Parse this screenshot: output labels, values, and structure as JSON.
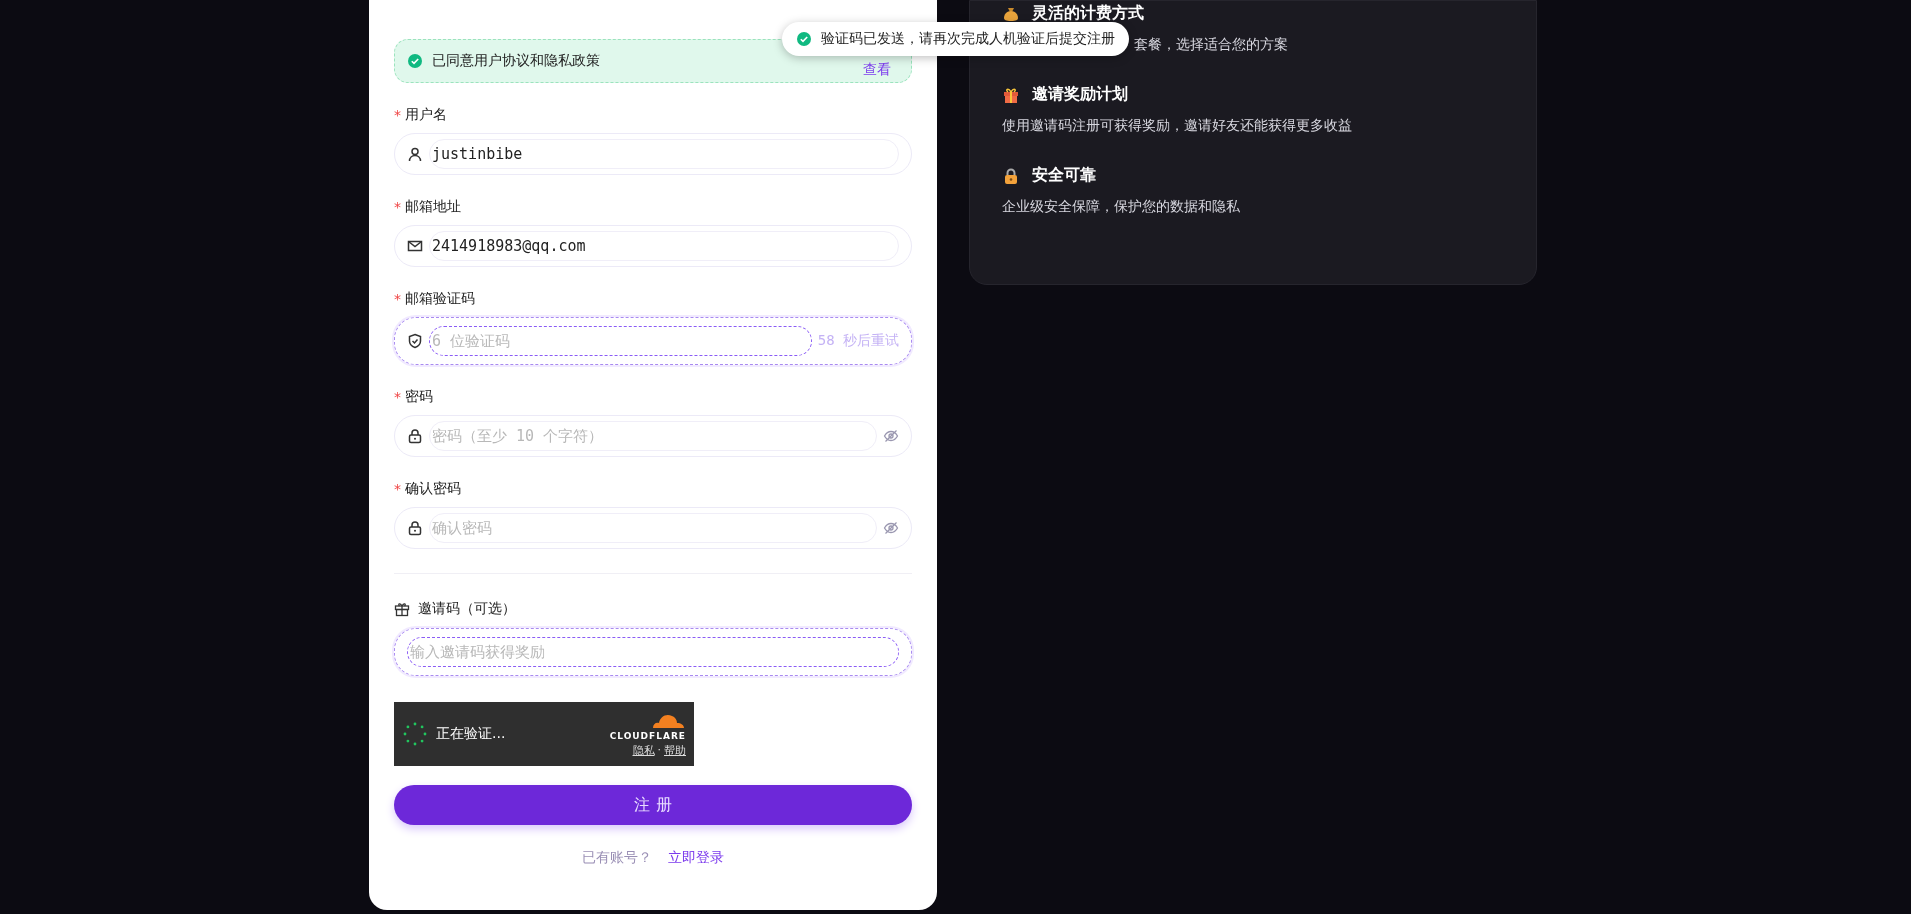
{
  "agreement": {
    "text": "已同意用户协议和隐私政策",
    "link": "查看",
    "checked": true
  },
  "fields": [
    {
      "kind": "text",
      "marker": "*",
      "label": "用户名",
      "value": "justinbibe",
      "focused": false
    },
    {
      "kind": "text",
      "marker": "*",
      "label": "邮箱地址",
      "value": "2414918983@qq.com",
      "focused": false
    },
    {
      "kind": "code",
      "marker": "*",
      "label": "邮箱验证码",
      "placeholder": "6 位验证码",
      "focused": true,
      "countdown": "58 秒后重试"
    },
    {
      "kind": "password",
      "marker": "*",
      "label": "密码",
      "placeholder": "密码（至少 10 个字符）",
      "focused": false
    },
    {
      "kind": "password",
      "marker": "*",
      "label": "确认密码",
      "placeholder": "确认密码",
      "focused": false
    }
  ],
  "invite": {
    "label": "邀请码（可选）",
    "placeholder": "输入邀请码获得奖励",
    "focused": true
  },
  "captcha": {
    "status": "正在验证...",
    "brand": "CLOUDFLARE",
    "links": [
      "隐私",
      "帮助"
    ],
    "separator": "·"
  },
  "submit": "注 册",
  "login": {
    "prompt": "已有账号？",
    "link": "立即登录"
  },
  "toast": {
    "text": "验证码已发送，请再次完成人机验证后提交注册"
  },
  "features": [
    {
      "title": "灵活的计费方式",
      "description": "套餐，选择适合您的方案"
    },
    {
      "title": "邀请奖励计划",
      "description": "使用邀请码注册可获得奖励，邀请好友还能获得更多收益"
    },
    {
      "title": "安全可靠",
      "description": "企业级安全保障，保护您的数据和隐私"
    }
  ]
}
